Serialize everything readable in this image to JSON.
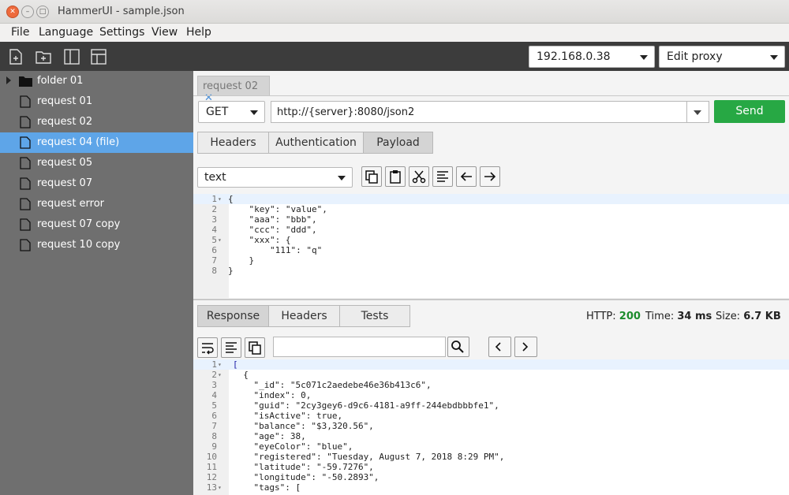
{
  "window": {
    "title": "HammerUI - sample.json"
  },
  "menu": [
    "File",
    "Language",
    "Settings",
    "View",
    "Help"
  ],
  "toolbar": {
    "icons": [
      "new-file-icon",
      "new-folder-icon",
      "split-vertical-icon",
      "split-horizontal-icon"
    ],
    "server": "192.168.0.38",
    "proxy": "Edit proxy"
  },
  "sidebar": {
    "items": [
      {
        "label": "folder 01",
        "type": "folder"
      },
      {
        "label": "request 01",
        "type": "file"
      },
      {
        "label": "request 02",
        "type": "file"
      },
      {
        "label": "request 04 (file)",
        "type": "file",
        "selected": true
      },
      {
        "label": "request 05",
        "type": "file"
      },
      {
        "label": "request 07",
        "type": "file"
      },
      {
        "label": "request error",
        "type": "file"
      },
      {
        "label": "request 07 copy",
        "type": "file"
      },
      {
        "label": "request 10 copy",
        "type": "file"
      }
    ]
  },
  "request": {
    "tab_label": "request 02",
    "tab_close": "✕",
    "method": "GET",
    "url": "http://{server}:8080/json2",
    "send_label": "Send",
    "tabs": [
      "Headers",
      "Authentication",
      "Payload"
    ],
    "active_tab": "Payload",
    "payload_type": "text",
    "payload_lines": [
      "{",
      "    \"key\": \"value\",",
      "    \"aaa\": \"bbb\",",
      "    \"ccc\": \"ddd\",",
      "    \"xxx\": {",
      "        \"111\": \"q\"",
      "    }",
      "}"
    ]
  },
  "response": {
    "tabs": [
      "Response",
      "Headers",
      "Tests"
    ],
    "active_tab": "Response",
    "http_label": "HTTP:",
    "http_code": "200",
    "time_label": "Time:",
    "time_value": "34 ms",
    "size_label": "Size:",
    "size_value": "6.7 KB",
    "search_placeholder": "",
    "body_lines": [
      "[",
      "  {",
      "    \"_id\": \"5c071c2aedebe46e36b413c6\",",
      "    \"index\": 0,",
      "    \"guid\": \"2cy3gey6-d9c6-4181-a9ff-244ebdbbbfe1\",",
      "    \"isActive\": true,",
      "    \"balance\": \"$3,320.56\",",
      "    \"age\": 38,",
      "    \"eyeColor\": \"blue\",",
      "    \"registered\": \"Tuesday, August 7, 2018 8:29 PM\",",
      "    \"latitude\": \"-59.7276\",",
      "    \"longitude\": \"-50.2893\",",
      "    \"tags\": ["
    ]
  },
  "colors": {
    "accent": "#5ea5e8",
    "send": "#27a844",
    "sidebar": "#6f6f6f",
    "toolbar": "#3c3c3c"
  }
}
